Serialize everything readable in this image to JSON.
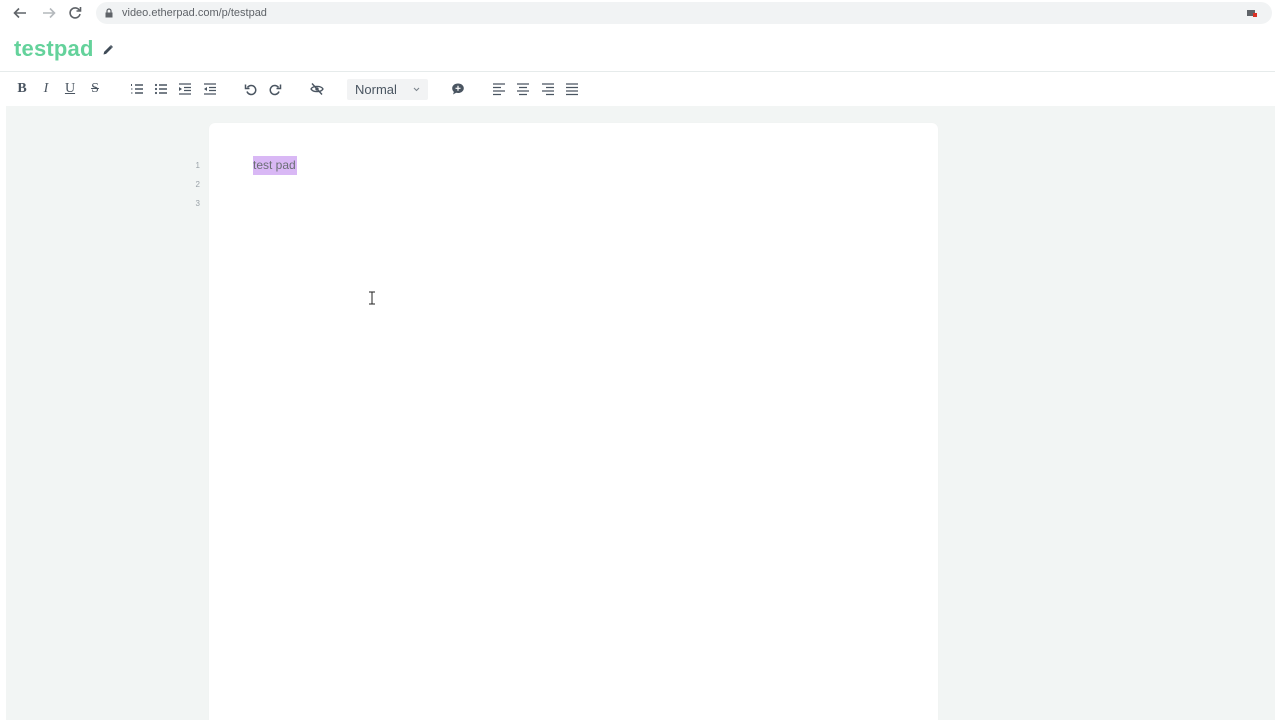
{
  "browser": {
    "url": "video.etherpad.com/p/testpad",
    "icons": [
      "back-icon",
      "forward-icon",
      "reload-icon",
      "lock-icon",
      "extension-icon"
    ]
  },
  "pad": {
    "title": "testpad"
  },
  "toolbar": {
    "bold": "B",
    "italic": "I",
    "underline": "U",
    "strikethrough": "S",
    "format_value": "Normal",
    "buttons": [
      "bold",
      "italic",
      "underline",
      "strikethrough",
      "ordered-list",
      "unordered-list",
      "indent",
      "outdent",
      "undo",
      "redo",
      "clear-authorship",
      "format-select",
      "comment",
      "align-left",
      "align-center",
      "align-right",
      "align-justify"
    ]
  },
  "editor": {
    "lines": [
      {
        "number": "1",
        "text": "test pad"
      },
      {
        "number": "2",
        "text": ""
      },
      {
        "number": "3",
        "text": ""
      }
    ],
    "highlight_color": "#d9b8f5"
  },
  "colors": {
    "brand": "#64d29b",
    "workspace": "#f2f5f4",
    "page": "#ffffff"
  }
}
